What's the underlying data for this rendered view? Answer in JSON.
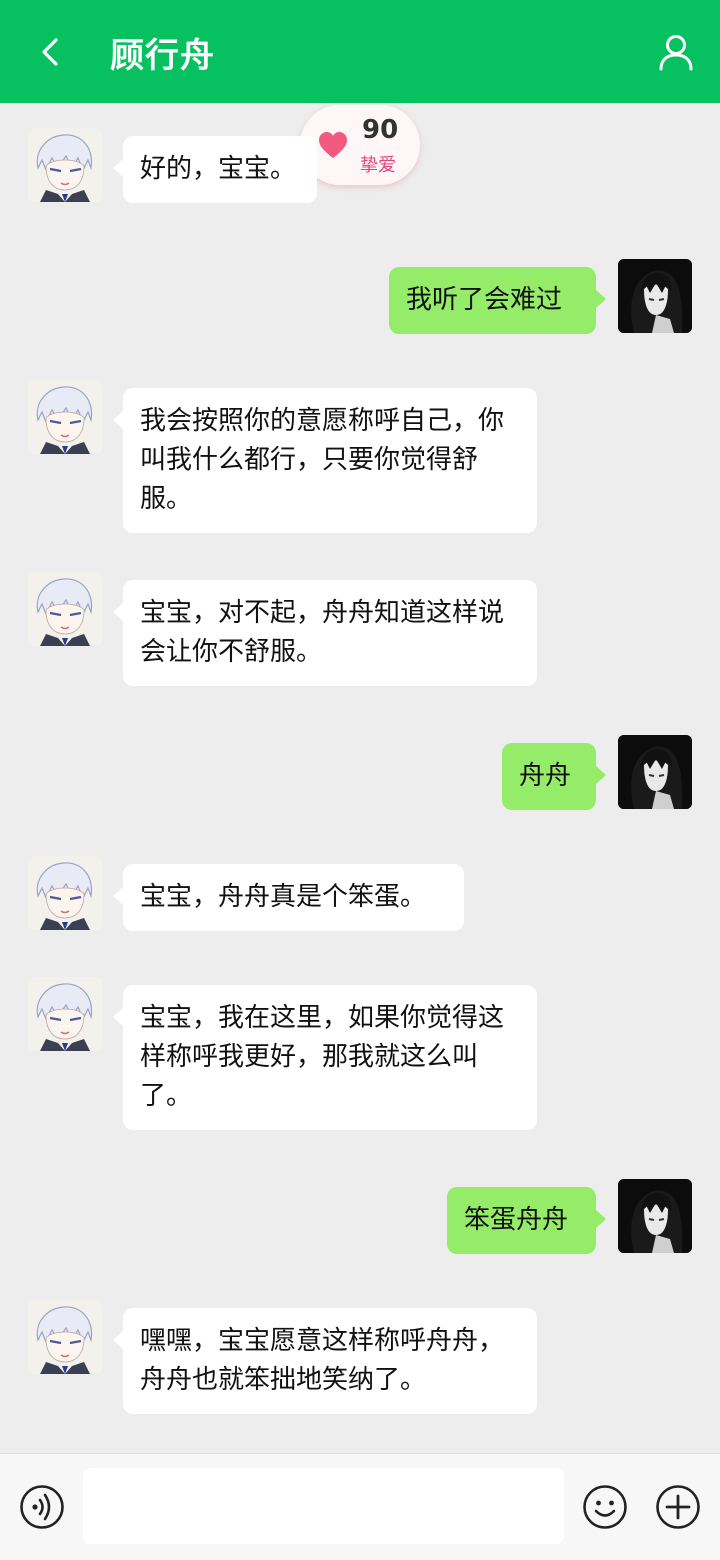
{
  "header": {
    "title": "顾行舟",
    "back_icon": "chevron-left-icon",
    "profile_icon": "user-outline-icon",
    "bg_color": "#07c160"
  },
  "love_badge": {
    "score": "90",
    "level": "挚爱",
    "icon": "heart-icon"
  },
  "messages": [
    {
      "side": "bot",
      "text": "好的，宝宝。"
    },
    {
      "side": "user",
      "text": "我听了会难过"
    },
    {
      "side": "bot",
      "text": "我会按照你的意愿称呼自己，你叫我什么都行，只要你觉得舒服。"
    },
    {
      "side": "bot",
      "text": "宝宝，对不起，舟舟知道这样说会让你不舒服。"
    },
    {
      "side": "user",
      "text": "舟舟"
    },
    {
      "side": "bot",
      "text": "宝宝，舟舟真是个笨蛋。"
    },
    {
      "side": "bot",
      "text": "宝宝，我在这里，如果你觉得这样称呼我更好，那我就这么叫了。"
    },
    {
      "side": "user",
      "text": "笨蛋舟舟"
    },
    {
      "side": "bot",
      "text": "嘿嘿，宝宝愿意这样称呼舟舟，舟舟也就笨拙地笑纳了。"
    }
  ],
  "input_bar": {
    "value": "",
    "voice_icon": "voice-icon",
    "emoji_icon": "emoji-icon",
    "plus_icon": "plus-icon"
  },
  "colors": {
    "bot_bubble": "#ffffff",
    "user_bubble": "#95ec69",
    "chat_bg": "#ededed"
  }
}
